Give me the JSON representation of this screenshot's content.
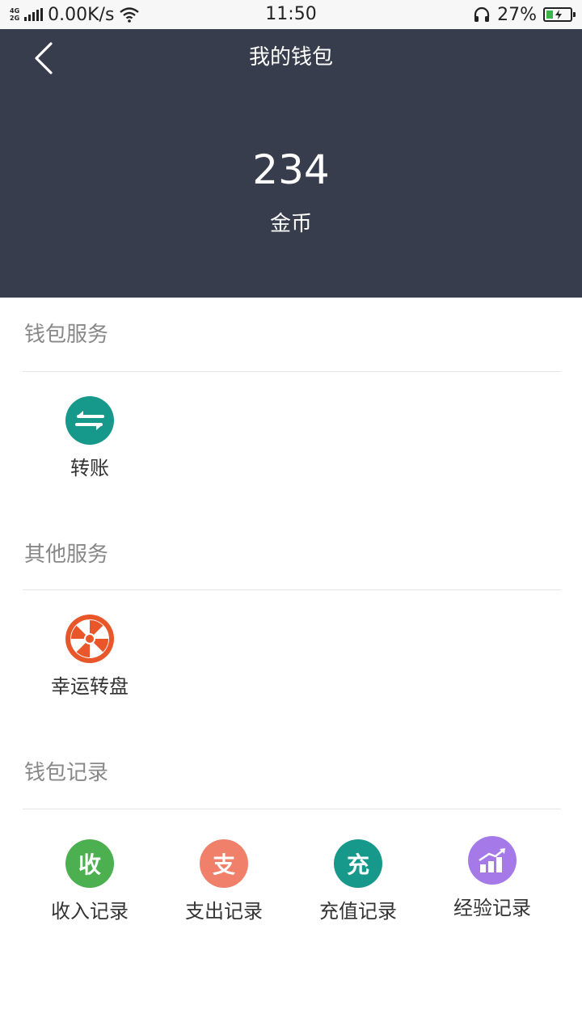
{
  "status_bar": {
    "network_top": "4G",
    "network_bottom": "2G",
    "speed": "0.00K/s",
    "time": "11:50",
    "battery": "27%",
    "battery_level": 0.27,
    "icons": [
      "signal-icon",
      "wifi-icon",
      "headphones-icon",
      "battery-icon"
    ]
  },
  "header": {
    "title": "我的钱包",
    "balance": "234",
    "unit": "金币",
    "background_color": "#373d4c"
  },
  "sections": {
    "wallet_service": {
      "title": "钱包服务",
      "items": [
        {
          "label": "转账",
          "icon": "transfer-icon",
          "color": "#16998a"
        }
      ]
    },
    "other_service": {
      "title": "其他服务",
      "items": [
        {
          "label": "幸运转盘",
          "icon": "wheel-icon",
          "color": "#e8562a"
        }
      ]
    },
    "wallet_records": {
      "title": "钱包记录",
      "items": [
        {
          "label": "收入记录",
          "icon_text": "收",
          "icon": "income-icon",
          "color": "#4caf50"
        },
        {
          "label": "支出记录",
          "icon_text": "支",
          "icon": "expense-icon",
          "color": "#f0806a"
        },
        {
          "label": "充值记录",
          "icon_text": "充",
          "icon": "recharge-icon",
          "color": "#16998a"
        },
        {
          "label": "经验记录",
          "icon": "experience-chart-icon",
          "color": "#a57ae8"
        }
      ]
    }
  }
}
